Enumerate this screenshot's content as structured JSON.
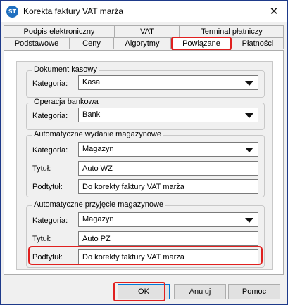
{
  "window": {
    "title": "Korekta faktury VAT marża",
    "icon_text": "ST",
    "close_glyph": "✕"
  },
  "tabs": {
    "row1": [
      "Podpis elektroniczny",
      "VAT",
      "Terminal płatniczy"
    ],
    "row2": [
      "Podstawowe",
      "Ceny",
      "Algorytmy",
      "Powiązane",
      "Płatności"
    ],
    "active": "Powiązane"
  },
  "groups": {
    "dokument_kasowy": {
      "title": "Dokument kasowy",
      "kategoria_label": "Kategoria:",
      "kategoria_value": "Kasa"
    },
    "operacja_bankowa": {
      "title": "Operacja bankowa",
      "kategoria_label": "Kategoria:",
      "kategoria_value": "Bank"
    },
    "wydanie": {
      "title": "Automatyczne wydanie magazynowe",
      "kategoria_label": "Kategoria:",
      "kategoria_value": "Magazyn",
      "tytul_label": "Tytuł:",
      "tytul_value": "Auto WZ",
      "podtytul_label": "Podtytuł:",
      "podtytul_value": "Do korekty faktury VAT marża"
    },
    "przyjecie": {
      "title": "Automatyczne przyjęcie magazynowe",
      "kategoria_label": "Kategoria:",
      "kategoria_value": "Magazyn",
      "tytul_label": "Tytuł:",
      "tytul_value": "Auto PZ",
      "podtytul_label": "Podtytuł:",
      "podtytul_value": "Do korekty faktury VAT marża"
    }
  },
  "buttons": {
    "ok": "OK",
    "cancel": "Anuluj",
    "help": "Pomoc"
  },
  "colors": {
    "highlight": "#e0201f",
    "app_icon": "#1f6fc0"
  }
}
